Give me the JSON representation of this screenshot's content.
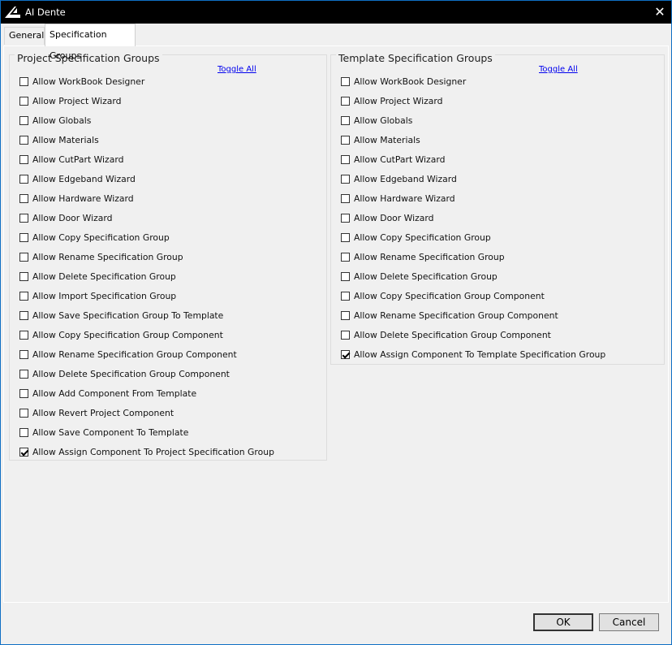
{
  "window": {
    "title": "AI Dente",
    "close_glyph": "✕"
  },
  "tabs": [
    "General",
    "Specification Groups"
  ],
  "project_group": {
    "title": "Project Specification Groups",
    "toggle_all": "Toggle All",
    "items": [
      {
        "label": "Allow WorkBook Designer",
        "checked": false
      },
      {
        "label": "Allow Project Wizard",
        "checked": false
      },
      {
        "label": "Allow Globals",
        "checked": false
      },
      {
        "label": "Allow Materials",
        "checked": false
      },
      {
        "label": "Allow CutPart Wizard",
        "checked": false
      },
      {
        "label": "Allow Edgeband Wizard",
        "checked": false
      },
      {
        "label": "Allow Hardware Wizard",
        "checked": false
      },
      {
        "label": "Allow Door Wizard",
        "checked": false
      },
      {
        "label": "Allow Copy Specification Group",
        "checked": false
      },
      {
        "label": "Allow Rename Specification Group",
        "checked": false
      },
      {
        "label": "Allow Delete Specification Group",
        "checked": false
      },
      {
        "label": "Allow Import Specification Group",
        "checked": false
      },
      {
        "label": "Allow Save Specification Group To Template",
        "checked": false
      },
      {
        "label": "Allow Copy Specification Group Component",
        "checked": false
      },
      {
        "label": "Allow Rename Specification Group Component",
        "checked": false
      },
      {
        "label": "Allow Delete Specification Group Component",
        "checked": false
      },
      {
        "label": "Allow Add Component From Template",
        "checked": false
      },
      {
        "label": "Allow Revert Project Component",
        "checked": false
      },
      {
        "label": "Allow Save Component To Template",
        "checked": false
      },
      {
        "label": "Allow Assign Component To Project Specification Group",
        "checked": true
      }
    ]
  },
  "template_group": {
    "title": "Template Specification Groups",
    "toggle_all": "Toggle All",
    "items": [
      {
        "label": "Allow WorkBook Designer",
        "checked": false
      },
      {
        "label": "Allow Project Wizard",
        "checked": false
      },
      {
        "label": "Allow Globals",
        "checked": false
      },
      {
        "label": "Allow Materials",
        "checked": false
      },
      {
        "label": "Allow CutPart Wizard",
        "checked": false
      },
      {
        "label": "Allow Edgeband Wizard",
        "checked": false
      },
      {
        "label": "Allow Hardware Wizard",
        "checked": false
      },
      {
        "label": "Allow Door Wizard",
        "checked": false
      },
      {
        "label": "Allow Copy Specification Group",
        "checked": false
      },
      {
        "label": "Allow Rename Specification Group",
        "checked": false
      },
      {
        "label": "Allow Delete Specification Group",
        "checked": false
      },
      {
        "label": "Allow Copy Specification Group Component",
        "checked": false
      },
      {
        "label": "Allow Rename Specification Group Component",
        "checked": false
      },
      {
        "label": "Allow Delete Specification Group Component",
        "checked": false
      },
      {
        "label": "Allow Assign Component To Template Specification Group",
        "checked": true
      }
    ]
  },
  "buttons": {
    "ok": "OK",
    "cancel": "Cancel"
  }
}
